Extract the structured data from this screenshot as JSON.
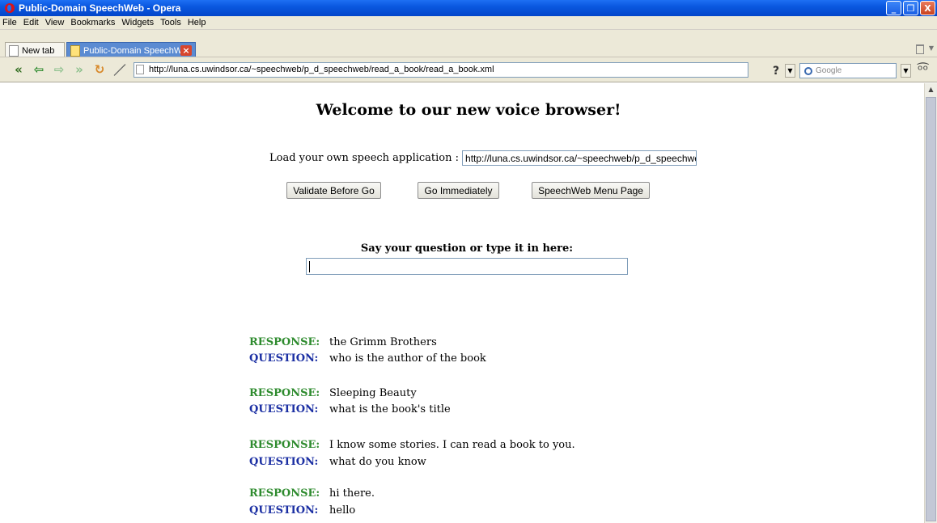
{
  "window": {
    "title": "Public-Domain SpeechWeb - Opera",
    "buttons": [
      "_",
      "❐",
      "X"
    ]
  },
  "menu": [
    "File",
    "Edit",
    "View",
    "Bookmarks",
    "Widgets",
    "Tools",
    "Help"
  ],
  "tabs": [
    {
      "label": "New tab"
    },
    {
      "label": "Public-Domain SpeechWeb",
      "active": true
    }
  ],
  "nav": {
    "url": "http://luna.cs.uwindsor.ca/~speechweb/p_d_speechweb/read_a_book/read_a_book.xml",
    "search_placeholder": "Google"
  },
  "page": {
    "heading": "Welcome to our new voice browser!",
    "load_label": "Load your own speech application :",
    "load_value": "http://luna.cs.uwindsor.ca/~speechweb/p_d_speechwe",
    "buttons": {
      "validate": "Validate Before Go",
      "go": "Go Immediately",
      "menu": "SpeechWeb Menu Page"
    },
    "ask_label": "Say your question or type it in here:",
    "ask_value": ""
  },
  "dialog": {
    "response_label": "RESPONSE:",
    "question_label": "QUESTION:",
    "entries": [
      {
        "response": "the Grimm Brothers",
        "question": "who is the author of the book"
      },
      {
        "response": "Sleeping Beauty",
        "question": "what is the book's title"
      },
      {
        "response": "I know some stories. I can read a book to you.",
        "question": "what do you know"
      },
      {
        "response": "hi there.",
        "question": "hello"
      }
    ]
  },
  "colors": {
    "response": "#2e8b2e",
    "question": "#1b2fa3",
    "titlebar": "#0a58e0"
  }
}
